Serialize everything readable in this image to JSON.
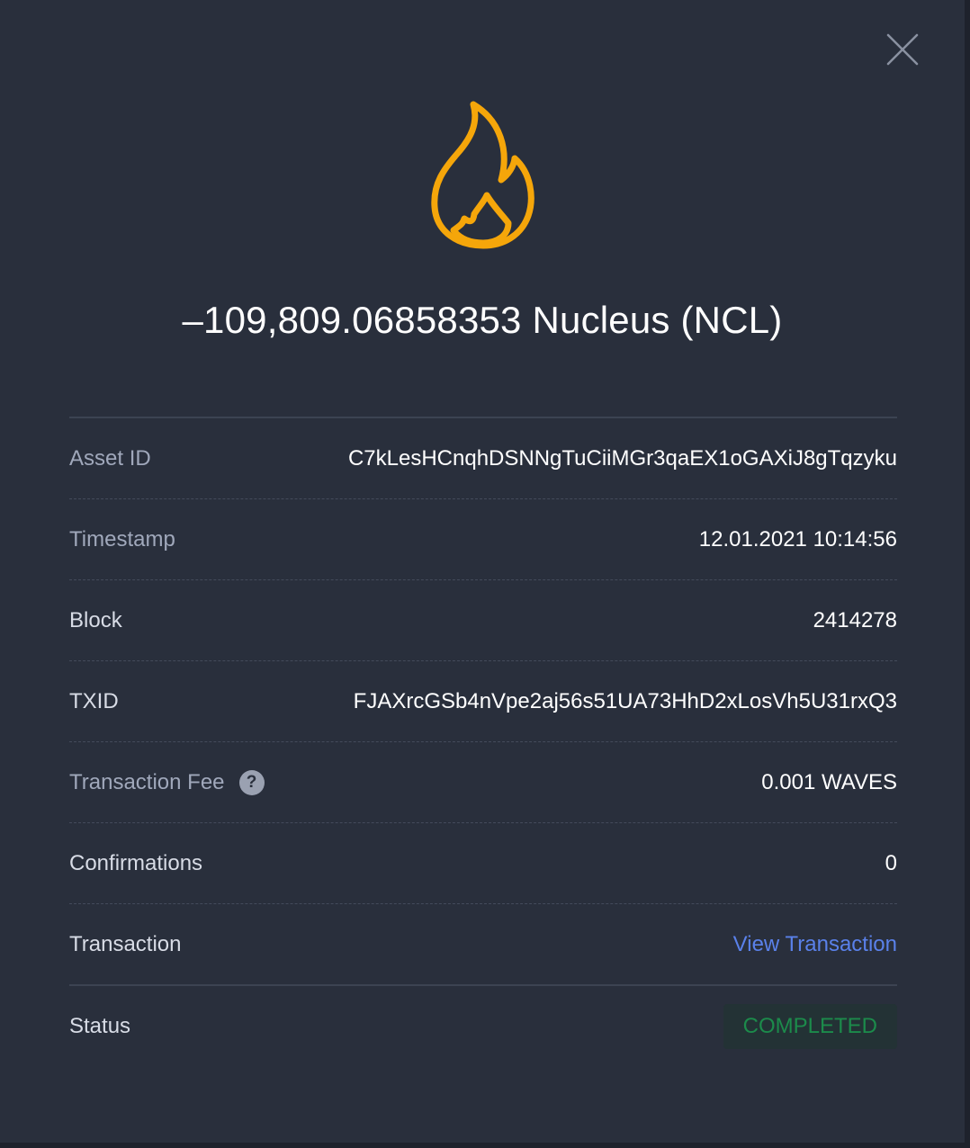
{
  "amount": "–109,809.06858353 Nucleus (NCL)",
  "icons": {
    "close": "close-icon",
    "burn": "flame-icon",
    "help": "question-icon"
  },
  "colors": {
    "flame": "#f5a60a",
    "link": "#5a81ea",
    "status": "#1c8b4b"
  },
  "rows": [
    {
      "label": "Asset ID",
      "value": "C7kLesHCnqhDSNNgTuCiiMGr3qaEX1oGAXiJ8gTqzyku"
    },
    {
      "label": "Timestamp",
      "value": "12.01.2021 10:14:56"
    },
    {
      "label": "Block",
      "value": "2414278"
    },
    {
      "label": "TXID",
      "value": "FJAXrcGSb4nVpe2aj56s51UA73HhD2xLosVh5U31rxQ3"
    },
    {
      "label": "Transaction Fee",
      "value": "0.001 WAVES",
      "help": "?"
    },
    {
      "label": "Confirmations",
      "value": "0"
    },
    {
      "label": "Transaction",
      "value": "View Transaction"
    },
    {
      "label": "Status",
      "value": "COMPLETED"
    }
  ]
}
